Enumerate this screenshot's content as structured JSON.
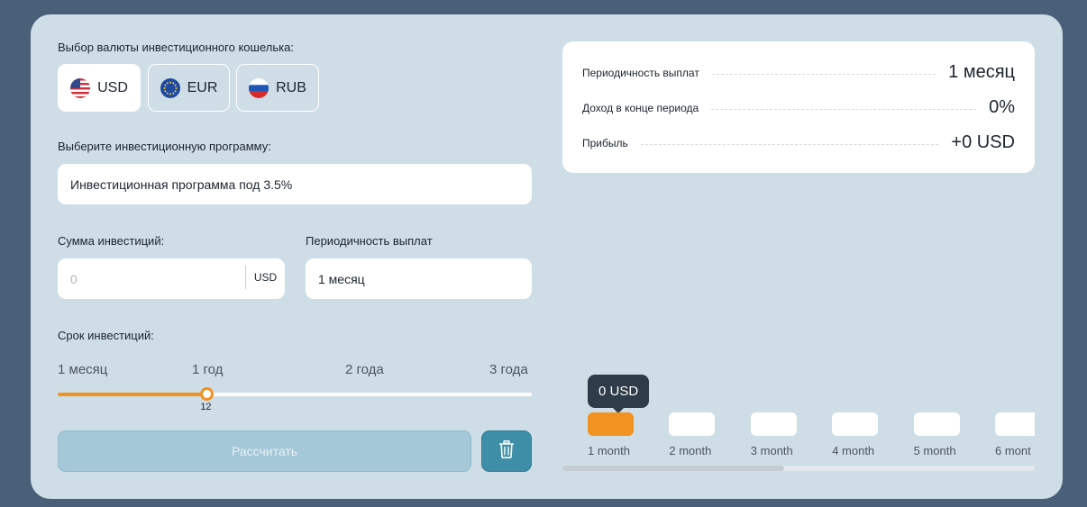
{
  "form": {
    "currency_label": "Выбор валюты инвестиционного кошелька:",
    "currencies": [
      {
        "code": "USD",
        "icon": "us-flag-icon",
        "selected": true
      },
      {
        "code": "EUR",
        "icon": "eu-flag-icon",
        "selected": false
      },
      {
        "code": "RUB",
        "icon": "ru-flag-icon",
        "selected": false
      }
    ],
    "program_label": "Выберите инвестиционную программу:",
    "program_value": "Инвестиционная программа под 3.5%",
    "amount_label": "Сумма инвестиций:",
    "amount_placeholder": "0",
    "amount_unit": "USD",
    "payout_label": "Периодичность выплат",
    "payout_value": "1 месяц",
    "term_label": "Срок инвестиций:",
    "term_ticks": [
      "1 месяц",
      "1 год",
      "2 года",
      "3 года"
    ],
    "term_value": "12",
    "term_min": 1,
    "term_max": 36,
    "calculate_label": "Рассчитать",
    "trash_icon": "trash-icon"
  },
  "summary": {
    "rows": [
      {
        "label": "Периодичность выплат",
        "value": "1 месяц"
      },
      {
        "label": "Доход в конце периода",
        "value": "0%"
      },
      {
        "label": "Прибыль",
        "value": "+0 USD"
      }
    ]
  },
  "chart_data": {
    "type": "bar",
    "categories": [
      "1 month",
      "2 month",
      "3 month",
      "4 month",
      "5 month",
      "6 mont"
    ],
    "values": [
      0,
      0,
      0,
      0,
      0,
      0
    ],
    "tooltip": "0 USD",
    "active_index": 0,
    "colors": {
      "active": "#f29220",
      "inactive": "#ffffff"
    }
  },
  "colors": {
    "accent": "#f29220",
    "primary": "#3d8ea6",
    "card": "#cfdde6",
    "background": "#4a6078"
  }
}
